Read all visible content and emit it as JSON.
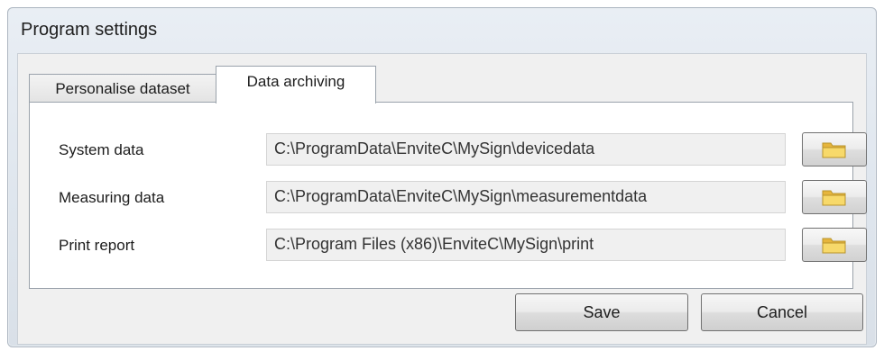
{
  "window": {
    "title": "Program settings"
  },
  "tabs": [
    {
      "label": "Personalise dataset",
      "active": false
    },
    {
      "label": "Data archiving",
      "active": true
    }
  ],
  "paths": [
    {
      "label": "System data",
      "value": "C:\\ProgramData\\EnviteC\\MySign\\devicedata",
      "browse_icon": "folder-icon"
    },
    {
      "label": "Measuring data",
      "value": "C:\\ProgramData\\EnviteC\\MySign\\measurementdata",
      "browse_icon": "folder-icon"
    },
    {
      "label": "Print report",
      "value": "C:\\Program Files (x86)\\EnviteC\\MySign\\print",
      "browse_icon": "folder-icon"
    }
  ],
  "buttons": {
    "save": "Save",
    "cancel": "Cancel"
  },
  "colors": {
    "folder": "#f2cf5b",
    "folder_edge": "#b8942b",
    "panel_bg": "#ffffff",
    "field_bg": "#f0f0f0"
  }
}
